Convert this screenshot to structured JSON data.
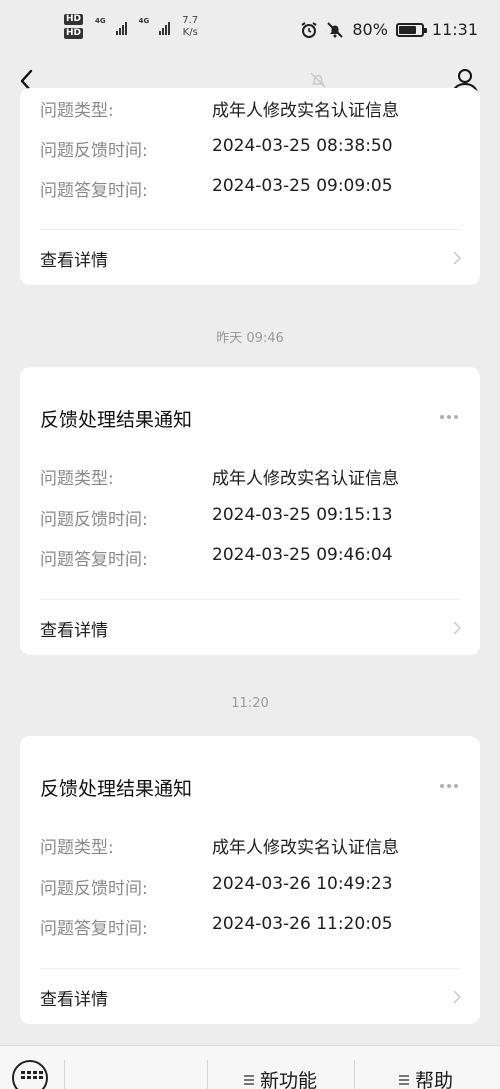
{
  "status_bar": {
    "network_speed_value": "7.7",
    "network_speed_unit": "K/s",
    "network_type_1": "4G",
    "network_type_2": "4G",
    "hd_label": "HD",
    "battery_percent": "80%",
    "battery_level": 0.8,
    "time": "11:31"
  },
  "nav": {
    "back_icon": "chevron-left-icon",
    "mute_icon": "bell-off-icon",
    "profile_icon": "person-icon"
  },
  "cards": [
    {
      "rows": [
        {
          "label": "问题类型:",
          "value": "成年人修改实名认证信息"
        },
        {
          "label": "问题反馈时间:",
          "value": "2024-03-25 08:38:50"
        },
        {
          "label": "问题答复时间:",
          "value": "2024-03-25 09:09:05"
        }
      ],
      "detail_label": "查看详情"
    },
    {
      "title": "反馈处理结果通知",
      "rows": [
        {
          "label": "问题类型:",
          "value": "成年人修改实名认证信息"
        },
        {
          "label": "问题反馈时间:",
          "value": "2024-03-25 09:15:13"
        },
        {
          "label": "问题答复时间:",
          "value": "2024-03-25 09:46:04"
        }
      ],
      "detail_label": "查看详情"
    },
    {
      "title": "反馈处理结果通知",
      "rows": [
        {
          "label": "问题类型:",
          "value": "成年人修改实名认证信息"
        },
        {
          "label": "问题反馈时间:",
          "value": "2024-03-26 10:49:23"
        },
        {
          "label": "问题答复时间:",
          "value": "2024-03-26 11:20:05"
        }
      ],
      "detail_label": "查看详情"
    }
  ],
  "timestamps": [
    "昨天 09:46",
    "11:20"
  ],
  "bottom_bar": {
    "keyboard_icon": "keyboard-icon",
    "menu_1": "新功能",
    "menu_2": "帮助"
  }
}
